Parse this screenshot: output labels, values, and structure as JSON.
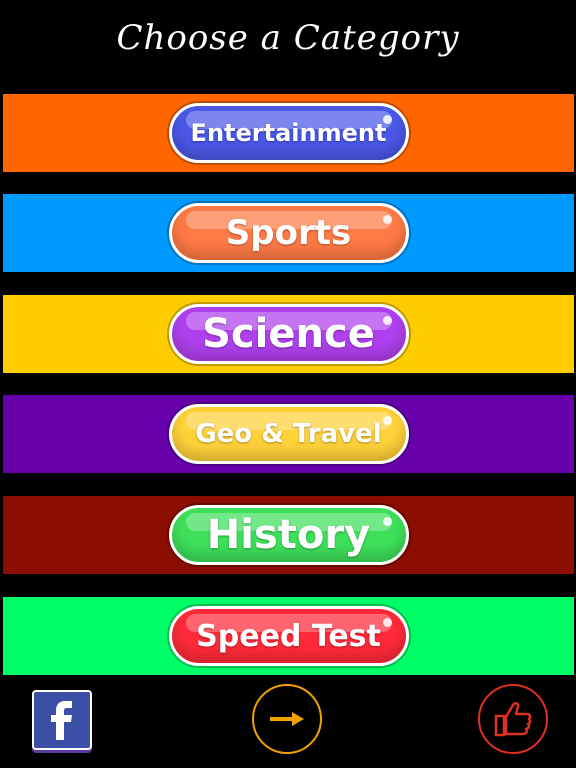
{
  "header": {
    "title": "Choose a Category"
  },
  "categories": [
    {
      "label": "Entertainment",
      "band_color": "#ff6600",
      "pill_color": "#4a58e8"
    },
    {
      "label": "Sports",
      "band_color": "#0099ff",
      "pill_color": "#ff7a45"
    },
    {
      "label": "Science",
      "band_color": "#ffcc00",
      "pill_color": "#b040ee"
    },
    {
      "label": "Geo & Travel",
      "band_color": "#6600aa",
      "pill_color": "#ffd23a"
    },
    {
      "label": "History",
      "band_color": "#8b0d00",
      "pill_color": "#3ee05a"
    },
    {
      "label": "Speed Test",
      "band_color": "#00ff66",
      "pill_color": "#ff2a3a"
    }
  ],
  "footer": {
    "facebook_icon": "facebook-icon",
    "next_icon": "arrow-right-icon",
    "like_icon": "thumbs-up-icon",
    "facebook_color": "#3b4fa6",
    "next_color": "#f2a200",
    "like_color": "#e0301e"
  }
}
